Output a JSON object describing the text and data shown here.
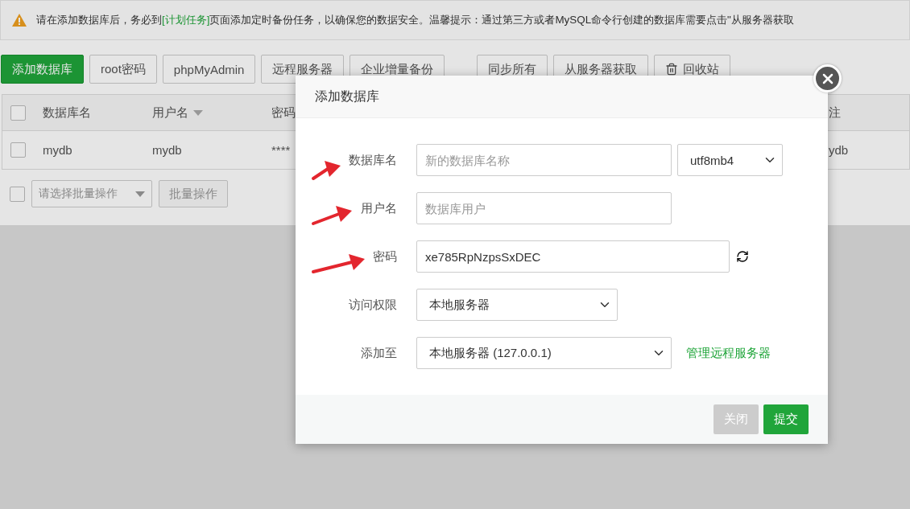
{
  "notice": {
    "before": "请在添加数据库后，务必到",
    "link": "[计划任务]",
    "after": "页面添加定时备份任务，以确保您的数据安全。温馨提示：通过第三方或者MySQL命令行创建的数据库需要点击\"从服务器获取"
  },
  "toolbar": {
    "groups": [
      [
        {
          "label": "添加数据库",
          "kind": "primary"
        },
        {
          "label": "root密码",
          "kind": "plain"
        },
        {
          "label": "phpMyAdmin",
          "kind": "plain"
        },
        {
          "label": "远程服务器",
          "kind": "plain"
        },
        {
          "label": "企业增量备份",
          "kind": "plain"
        }
      ],
      [
        {
          "label": "同步所有",
          "kind": "plain"
        },
        {
          "label": "从服务器获取",
          "kind": "plain"
        },
        {
          "label": "回收站",
          "kind": "icon"
        }
      ]
    ]
  },
  "table": {
    "header_checked": false,
    "columns": [
      "数据库名",
      "用户名",
      "密码",
      "注"
    ],
    "rows": [
      {
        "checked": false,
        "cells": [
          "mydb",
          "mydb",
          "****",
          "ydb"
        ]
      }
    ],
    "batch": {
      "checked": false,
      "placeholder": "请选择批量操作",
      "button": "批量操作"
    }
  },
  "dialog": {
    "title": "添加数据库",
    "fields": [
      {
        "kind": "input_select",
        "label": "数据库名",
        "placeholder": "新的数据库名称",
        "select": "utf8mb4"
      },
      {
        "kind": "input",
        "label": "用户名",
        "placeholder": "数据库用户"
      },
      {
        "kind": "password",
        "label": "密码",
        "value": "xe785RpNzpsSxDEC"
      },
      {
        "kind": "select",
        "label": "访问权限",
        "value": "本地服务器"
      },
      {
        "kind": "select_link",
        "label": "添加至",
        "value": "本地服务器 (127.0.0.1)",
        "link": "管理远程服务器"
      }
    ],
    "buttons": [
      {
        "label": "关闭",
        "kind": "secondary"
      },
      {
        "label": "提交",
        "kind": "primary"
      }
    ]
  }
}
